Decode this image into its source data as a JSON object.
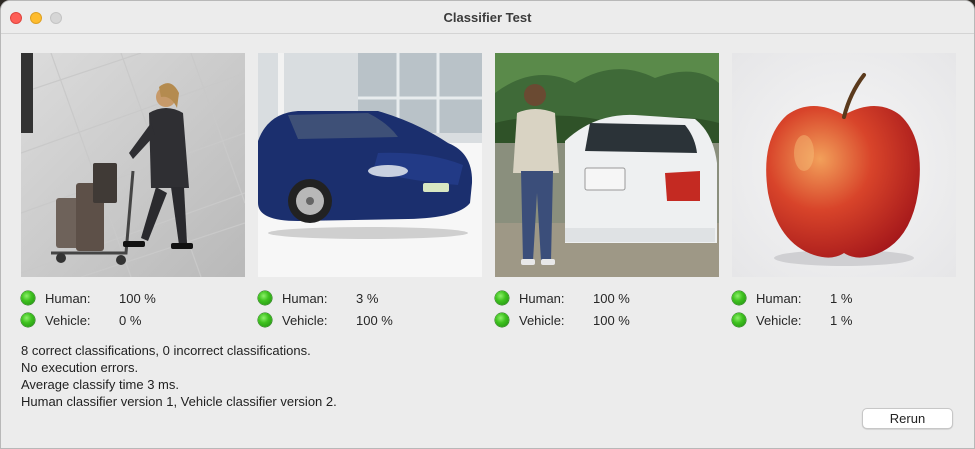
{
  "window": {
    "title": "Classifier Test"
  },
  "samples": [
    {
      "image": "person-with-luggage-cart-photo",
      "results": [
        {
          "label": "Human:",
          "value": "100 %",
          "status": "green"
        },
        {
          "label": "Vehicle:",
          "value": "0 %",
          "status": "green"
        }
      ]
    },
    {
      "image": "blue-sports-car-photo",
      "results": [
        {
          "label": "Human:",
          "value": "3 %",
          "status": "green"
        },
        {
          "label": "Vehicle:",
          "value": "100 %",
          "status": "green"
        }
      ]
    },
    {
      "image": "man-beside-white-car-photo",
      "results": [
        {
          "label": "Human:",
          "value": "100 %",
          "status": "green"
        },
        {
          "label": "Vehicle:",
          "value": "100 %",
          "status": "green"
        }
      ]
    },
    {
      "image": "red-apple-photo",
      "results": [
        {
          "label": "Human:",
          "value": "1 %",
          "status": "green"
        },
        {
          "label": "Vehicle:",
          "value": "1 %",
          "status": "green"
        }
      ]
    }
  ],
  "summary": {
    "line1": "8 correct classifications, 0 incorrect classifications.",
    "line2": "No execution errors.",
    "line3": "Average classify time 3 ms.",
    "line4": "Human classifier version 1, Vehicle classifier version 2."
  },
  "buttons": {
    "rerun": "Rerun"
  },
  "colors": {
    "status_green": "#3fc21f",
    "close": "#fe5f57",
    "minimize": "#febc2e",
    "maximize": "#d6d6d6"
  }
}
